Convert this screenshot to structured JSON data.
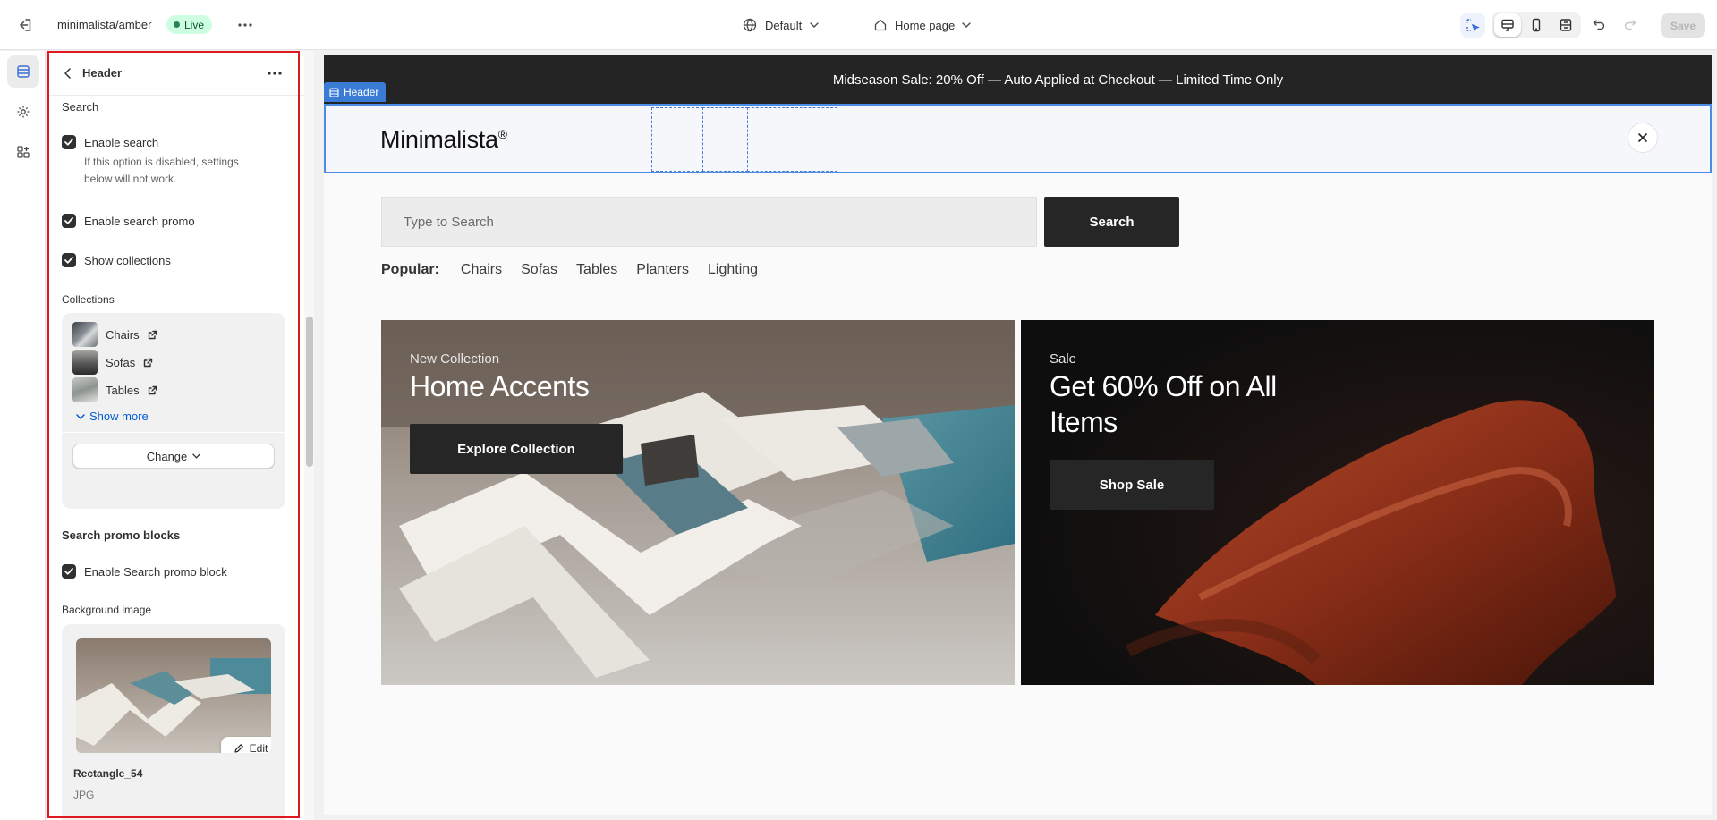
{
  "topbar": {
    "store_name": "minimalista/amber",
    "status": "Live",
    "theme_default": "Default",
    "page_selector": "Home page",
    "save_label": "Save"
  },
  "panel": {
    "title": "Header",
    "search_section": "Search",
    "enable_search": "Enable search",
    "enable_search_help": "If this option is disabled, settings below will not work.",
    "enable_search_promo": "Enable search promo",
    "show_collections": "Show collections",
    "collections_label": "Collections",
    "collections": [
      {
        "name": "Chairs"
      },
      {
        "name": "Sofas"
      },
      {
        "name": "Tables"
      }
    ],
    "show_more": "Show more",
    "change": "Change",
    "promo_blocks_heading": "Search promo blocks",
    "enable_promo_block": "Enable Search promo block",
    "background_image_label": "Background image",
    "edit": "Edit",
    "image_name": "Rectangle_54",
    "image_type": "JPG"
  },
  "preview": {
    "announcement": "Midseason Sale: 20% Off — Auto Applied at Checkout — Limited Time Only",
    "header_tag": "Header",
    "logo": "Minimalista",
    "logo_mark": "®",
    "search_placeholder": "Type to Search",
    "search_button": "Search",
    "popular_label": "Popular:",
    "popular_links": [
      "Chairs",
      "Sofas",
      "Tables",
      "Planters",
      "Lighting"
    ],
    "card_left": {
      "kicker": "New Collection",
      "title": "Home Accents",
      "button": "Explore Collection"
    },
    "card_right": {
      "kicker": "Sale",
      "title": "Get 60% Off on All Items",
      "button": "Shop Sale"
    }
  },
  "colors": {
    "accent_blue": "#4a8ce6",
    "live_green": "#29845a",
    "focus_red": "#e0181f",
    "button_dark": "#262626"
  }
}
